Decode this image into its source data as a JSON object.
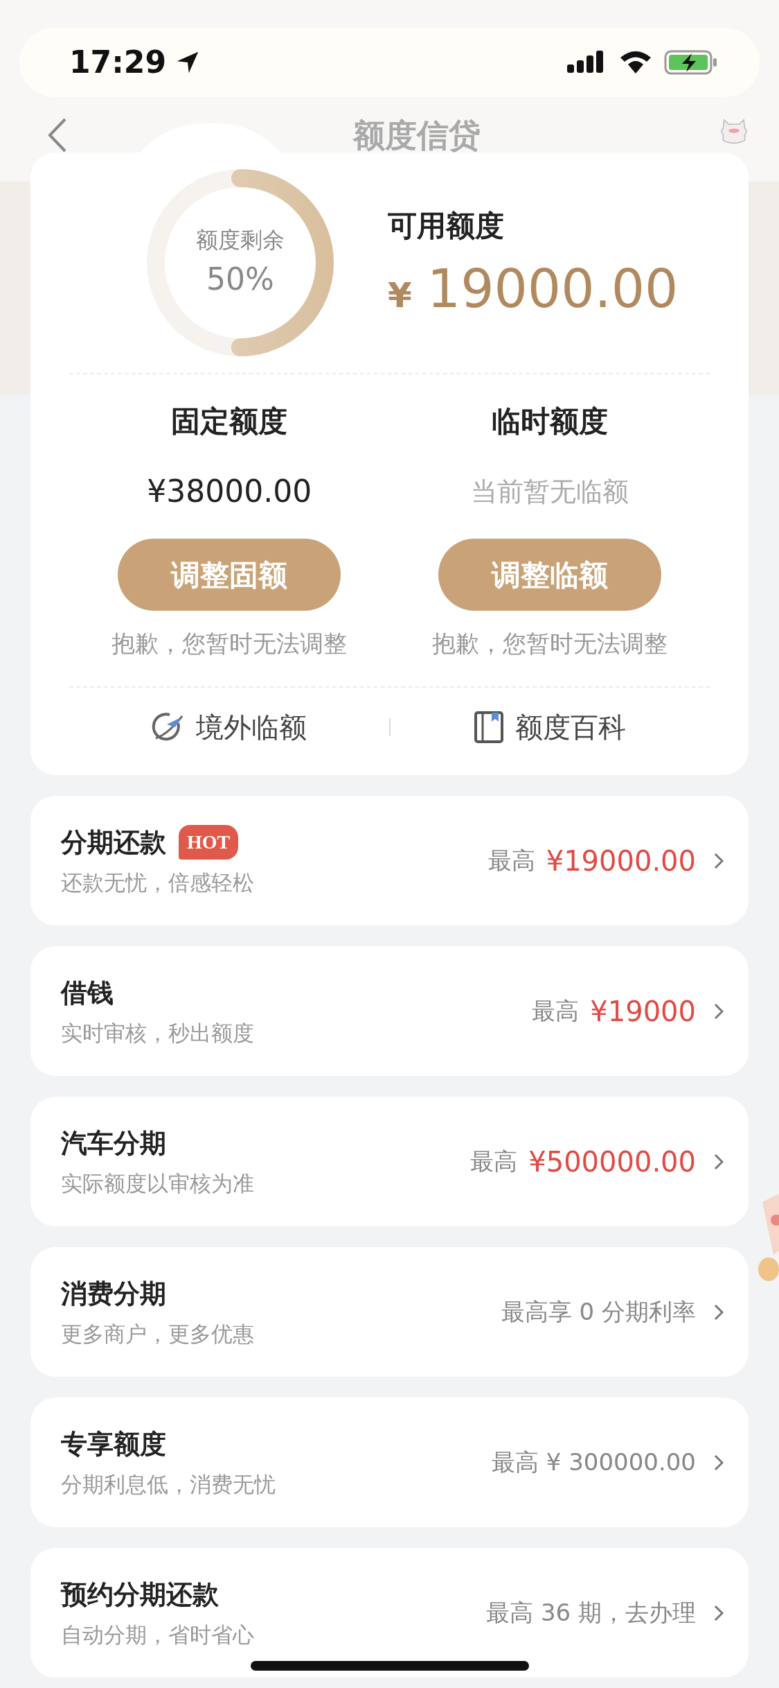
{
  "status_bar": {
    "time": "17:29"
  },
  "nav": {
    "title": "额度信贷"
  },
  "quota": {
    "ring_label": "额度剩余",
    "ring_percent": "50%",
    "level": 0.5,
    "available_label": "可用额度",
    "currency": "¥",
    "available_amount": "19000.00",
    "columns": [
      {
        "title": "固定额度",
        "value": "¥38000.00",
        "kind": "amount",
        "button": "调整固额",
        "note": "抱歉，您暂时无法调整"
      },
      {
        "title": "临时额度",
        "value": "当前暂无临额",
        "kind": "hint",
        "button": "调整临额",
        "note": "抱歉，您暂时无法调整"
      }
    ],
    "links": [
      {
        "kind": "plane",
        "label": "境外临额"
      },
      {
        "kind": "book",
        "label": "额度百科"
      }
    ]
  },
  "products": [
    {
      "title": "分期还款",
      "badge": "HOT",
      "subtitle": "还款无忧，倍感轻松",
      "kind": "price",
      "label": "最高",
      "amount": "¥19000.00"
    },
    {
      "title": "借钱",
      "subtitle": "实时审核，秒出额度",
      "kind": "price",
      "label": "最高",
      "amount": "¥19000"
    },
    {
      "title": "汽车分期",
      "subtitle": "实际额度以审核为准",
      "kind": "price",
      "label": "最高",
      "amount": "¥500000.00"
    },
    {
      "title": "消费分期",
      "subtitle": "更多商户，更多优惠",
      "kind": "text",
      "text": "最高享 0 分期利率"
    },
    {
      "title": "专享额度",
      "subtitle": "分期利息低，消费无忧",
      "kind": "text",
      "text": "最高 ¥ 300000.00"
    },
    {
      "title": "预约分期还款",
      "subtitle": "自动分期，省时省心",
      "kind": "text",
      "text": "最高 36 期，去办理"
    }
  ]
}
